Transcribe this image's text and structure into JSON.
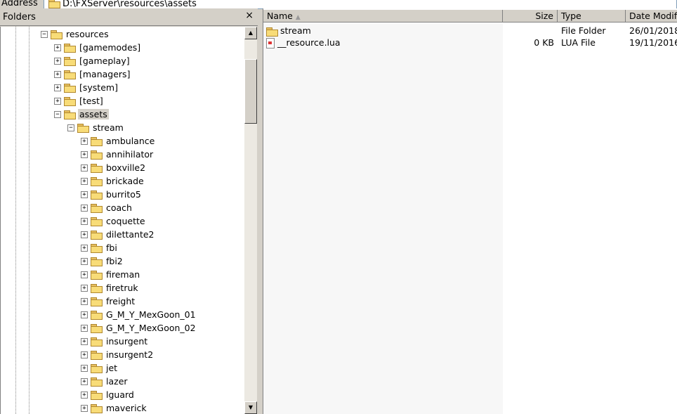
{
  "address": {
    "label": "Address",
    "path": "D:\\FXServer\\resources\\assets"
  },
  "folders_pane": {
    "title": "Folders",
    "close": "×"
  },
  "tree": [
    {
      "label": "resources",
      "level": 0,
      "expander": "-"
    },
    {
      "label": "[gamemodes]",
      "level": 1,
      "expander": "+"
    },
    {
      "label": "[gameplay]",
      "level": 1,
      "expander": "+"
    },
    {
      "label": "[managers]",
      "level": 1,
      "expander": "+"
    },
    {
      "label": "[system]",
      "level": 1,
      "expander": "+"
    },
    {
      "label": "[test]",
      "level": 1,
      "expander": "+"
    },
    {
      "label": "assets",
      "level": 1,
      "expander": "-",
      "selected": true
    },
    {
      "label": "stream",
      "level": 2,
      "expander": "-"
    },
    {
      "label": "ambulance",
      "level": 3,
      "expander": "+"
    },
    {
      "label": "annihilator",
      "level": 3,
      "expander": "+"
    },
    {
      "label": "boxville2",
      "level": 3,
      "expander": "+"
    },
    {
      "label": "brickade",
      "level": 3,
      "expander": "+"
    },
    {
      "label": "burrito5",
      "level": 3,
      "expander": "+"
    },
    {
      "label": "coach",
      "level": 3,
      "expander": "+"
    },
    {
      "label": "coquette",
      "level": 3,
      "expander": "+"
    },
    {
      "label": "dilettante2",
      "level": 3,
      "expander": "+"
    },
    {
      "label": "fbi",
      "level": 3,
      "expander": "+"
    },
    {
      "label": "fbi2",
      "level": 3,
      "expander": "+"
    },
    {
      "label": "fireman",
      "level": 3,
      "expander": "+"
    },
    {
      "label": "firetruk",
      "level": 3,
      "expander": "+"
    },
    {
      "label": "freight",
      "level": 3,
      "expander": "+"
    },
    {
      "label": "G_M_Y_MexGoon_01",
      "level": 3,
      "expander": "+"
    },
    {
      "label": "G_M_Y_MexGoon_02",
      "level": 3,
      "expander": "+"
    },
    {
      "label": "insurgent",
      "level": 3,
      "expander": "+"
    },
    {
      "label": "insurgent2",
      "level": 3,
      "expander": "+"
    },
    {
      "label": "jet",
      "level": 3,
      "expander": "+"
    },
    {
      "label": "lazer",
      "level": 3,
      "expander": "+"
    },
    {
      "label": "lguard",
      "level": 3,
      "expander": "+"
    },
    {
      "label": "maverick",
      "level": 3,
      "expander": "+"
    }
  ],
  "list": {
    "columns": [
      "Name",
      "Size",
      "Type",
      "Date Modified"
    ],
    "rows": [
      {
        "name": "stream",
        "size": "",
        "type": "File Folder",
        "date": "26/01/2018",
        "icon": "folder"
      },
      {
        "name": "__resource.lua",
        "size": "0 KB",
        "type": "LUA File",
        "date": "19/11/2016",
        "icon": "lua-file"
      }
    ]
  }
}
